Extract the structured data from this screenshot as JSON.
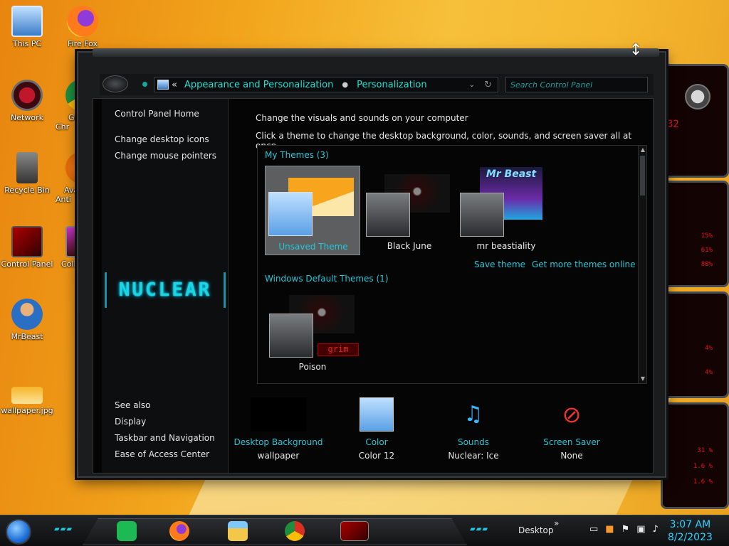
{
  "desktop": {
    "icons": [
      {
        "label": "This PC"
      },
      {
        "label": "Fire Fox"
      },
      {
        "label": "Network"
      },
      {
        "label": "Go Chr"
      },
      {
        "label": "Recycle Bin"
      },
      {
        "label": "Avas Anti"
      },
      {
        "label": "Control Panel"
      },
      {
        "label": "Collab"
      },
      {
        "label": "MrBeast"
      },
      {
        "label": "wallpaper.jpg"
      }
    ]
  },
  "window": {
    "breadcrumb": {
      "chevron": "«",
      "parent": "Appearance and Personalization",
      "separator": "●",
      "current": "Personalization",
      "dropdown": "⌄",
      "refresh": "↻"
    },
    "search_placeholder": "Search Control Panel",
    "sidebar": {
      "home": "Control Panel Home",
      "links": [
        "Change desktop icons",
        "Change mouse pointers"
      ],
      "logo_text": "NUCLEAR",
      "see_also": "See also",
      "see_also_links": [
        "Display",
        "Taskbar and Navigation",
        "Ease of Access Center"
      ]
    },
    "main": {
      "heading": "Change the visuals and sounds on your computer",
      "subheading": "Click a theme to change the desktop background, color, sounds, and screen saver all at once.",
      "my_themes_title": "My Themes (3)",
      "my_themes": [
        "Unsaved Theme",
        "Black June",
        "mr beastiality"
      ],
      "save_theme": "Save theme",
      "get_more": "Get more themes online",
      "default_themes_title": "Windows Default Themes (1)",
      "default_themes": [
        "Poison"
      ],
      "poison_badge": "grim",
      "mrbeast_thumb_text": "Mr Beast",
      "bottom": [
        {
          "label": "Desktop Background",
          "value": "wallpaper"
        },
        {
          "label": "Color",
          "value": "Color 12"
        },
        {
          "label": "Sounds",
          "value": "Nuclear: Ice"
        },
        {
          "label": "Screen Saver",
          "value": "None"
        }
      ]
    }
  },
  "taskbar": {
    "desktop_label": "Desktop",
    "chevron": "»",
    "time": "3:07 AM",
    "date": "8/2/2023"
  },
  "colors": {
    "accent_cyan": "#22c8d8",
    "gadget_red": "#e8121f"
  },
  "gadgets": {
    "lines": [
      "32",
      "15%",
      "61%",
      "88%",
      "4%",
      "4%",
      "31 %",
      "1.6 %",
      "1.6 %"
    ]
  }
}
